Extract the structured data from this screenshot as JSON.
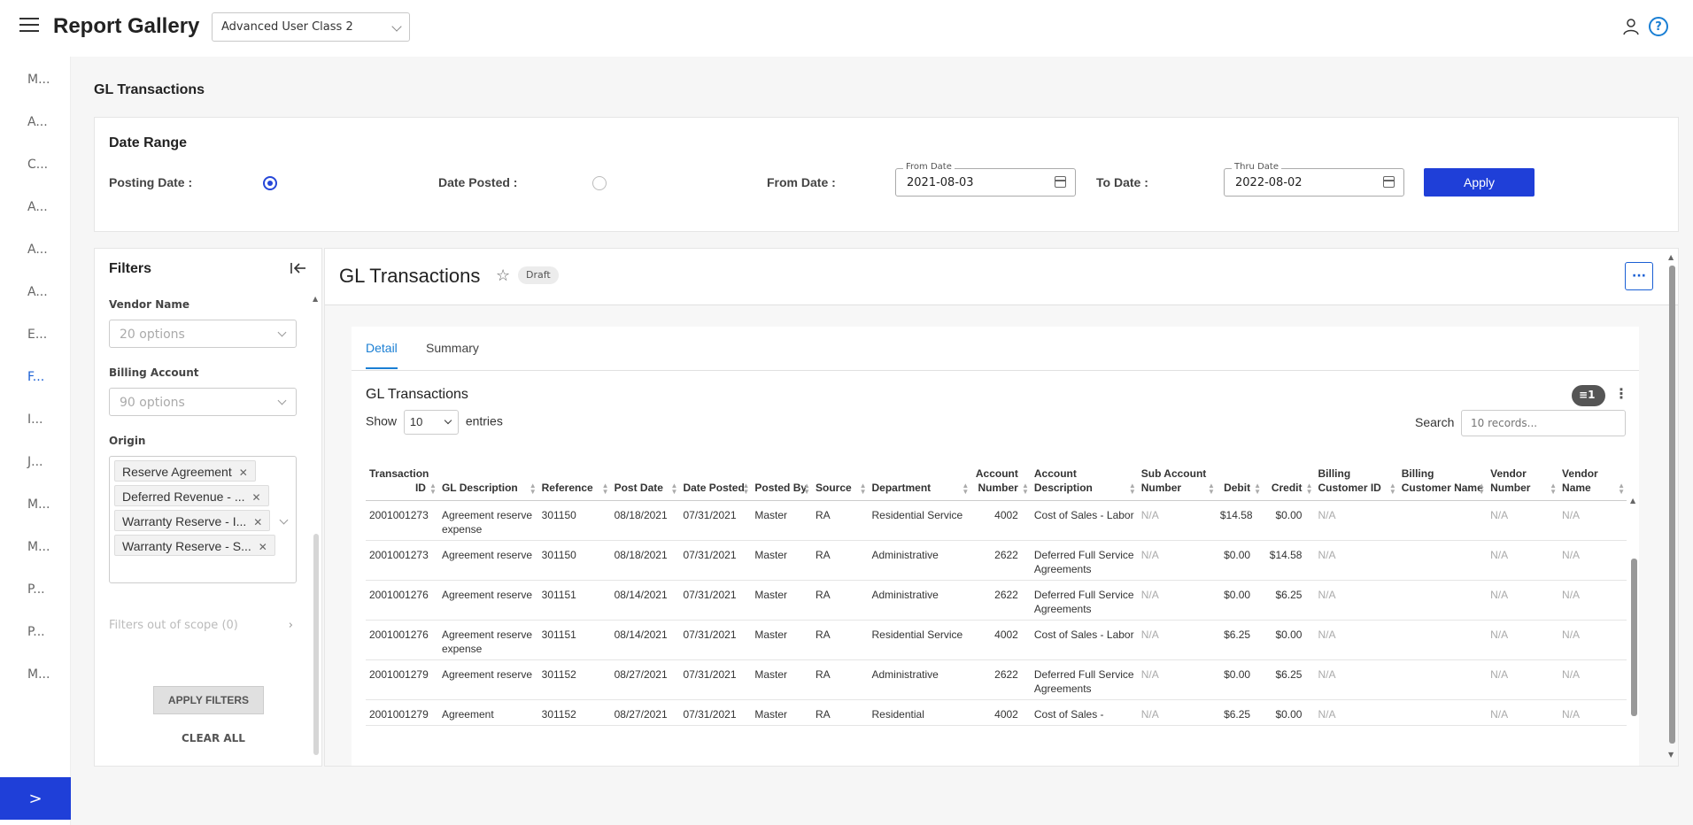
{
  "header": {
    "app_title": "Report Gallery",
    "class_select": "Advanced User Class 2"
  },
  "nav": {
    "items": [
      "M...",
      "A...",
      "C...",
      "A...",
      "A...",
      "A...",
      "E...",
      "F...",
      "I...",
      "J...",
      "M...",
      "M...",
      "P...",
      "P...",
      "M..."
    ],
    "active_index": 7,
    "expand_glyph": ">"
  },
  "page": {
    "title": "GL Transactions"
  },
  "date_range": {
    "title": "Date Range",
    "posting_date_label": "Posting Date :",
    "date_posted_label": "Date Posted :",
    "from_date_label": "From Date :",
    "to_date_label": "To Date :",
    "from_legend": "From Date",
    "from_value": "2021-08-03",
    "thru_legend": "Thru Date",
    "thru_value": "2022-08-02",
    "apply_label": "Apply"
  },
  "filters": {
    "title": "Filters",
    "vendor_label": "Vendor Name",
    "vendor_placeholder": "20 options",
    "billing_label": "Billing Account",
    "billing_placeholder": "90 options",
    "origin_label": "Origin",
    "origin_chips": [
      "Reserve Agreement",
      "Deferred Revenue - ...",
      "Warranty Reserve - I...",
      "Warranty Reserve - S..."
    ],
    "out_of_scope": "Filters out of scope (0)",
    "apply_label": "APPLY FILTERS",
    "clear_label": "CLEAR ALL"
  },
  "report": {
    "title": "GL Transactions",
    "badge": "Draft",
    "more_glyph": "···",
    "tabs": [
      "Detail",
      "Summary"
    ],
    "grid_title": "GL Transactions",
    "filter_count": "1",
    "show_label": "Show",
    "show_value": "10",
    "entries_label": "entries",
    "search_label": "Search",
    "search_placeholder": "10 records..."
  },
  "table": {
    "columns": [
      "Transaction ID",
      "GL Description",
      "Reference",
      "Post Date",
      "Date Posted",
      "Posted By",
      "Source",
      "Department",
      "Account Number",
      "Account Description",
      "Sub Account Number",
      "Debit",
      "Credit",
      "Billing Customer ID",
      "Billing Customer Name",
      "Vendor Number",
      "Vendor Name"
    ],
    "rows": [
      [
        "2001001273",
        "Agreement reserve expense",
        "301150",
        "08/18/2021",
        "07/31/2021",
        "Master",
        "RA",
        "Residential Service",
        "4002",
        "Cost of Sales - Labor",
        "N/A",
        "$14.58",
        "$0.00",
        "N/A",
        "",
        "N/A",
        "N/A"
      ],
      [
        "2001001273",
        "Agreement reserve",
        "301150",
        "08/18/2021",
        "07/31/2021",
        "Master",
        "RA",
        "Administrative",
        "2622",
        "Deferred Full Service Agreements",
        "N/A",
        "$0.00",
        "$14.58",
        "N/A",
        "",
        "N/A",
        "N/A"
      ],
      [
        "2001001276",
        "Agreement reserve",
        "301151",
        "08/14/2021",
        "07/31/2021",
        "Master",
        "RA",
        "Administrative",
        "2622",
        "Deferred Full Service Agreements",
        "N/A",
        "$0.00",
        "$6.25",
        "N/A",
        "",
        "N/A",
        "N/A"
      ],
      [
        "2001001276",
        "Agreement reserve expense",
        "301151",
        "08/14/2021",
        "07/31/2021",
        "Master",
        "RA",
        "Residential Service",
        "4002",
        "Cost of Sales - Labor",
        "N/A",
        "$6.25",
        "$0.00",
        "N/A",
        "",
        "N/A",
        "N/A"
      ],
      [
        "2001001279",
        "Agreement reserve",
        "301152",
        "08/27/2021",
        "07/31/2021",
        "Master",
        "RA",
        "Administrative",
        "2622",
        "Deferred Full Service Agreements",
        "N/A",
        "$0.00",
        "$6.25",
        "N/A",
        "",
        "N/A",
        "N/A"
      ],
      [
        "2001001279",
        "Agreement",
        "301152",
        "08/27/2021",
        "07/31/2021",
        "Master",
        "RA",
        "Residential",
        "4002",
        "Cost of Sales -",
        "N/A",
        "$6.25",
        "$0.00",
        "N/A",
        "",
        "N/A",
        "N/A"
      ]
    ]
  }
}
